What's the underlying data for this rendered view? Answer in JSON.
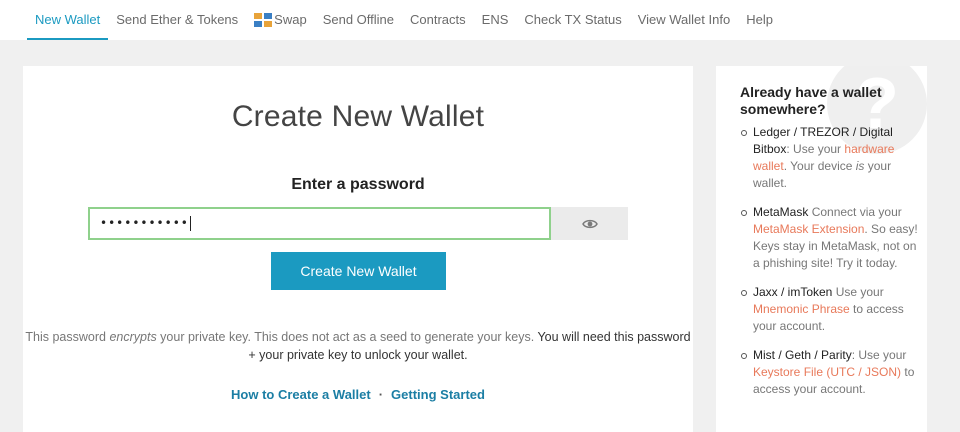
{
  "nav": {
    "items": [
      {
        "label": "New Wallet"
      },
      {
        "label": "Send Ether & Tokens"
      },
      {
        "label": "Swap"
      },
      {
        "label": "Send Offline"
      },
      {
        "label": "Contracts"
      },
      {
        "label": "ENS"
      },
      {
        "label": "Check TX Status"
      },
      {
        "label": "View Wallet Info"
      },
      {
        "label": "Help"
      }
    ],
    "active": "New Wallet"
  },
  "main": {
    "title": "Create New Wallet",
    "password_label": "Enter a password",
    "password_value": "•••••••••••",
    "create_button": "Create New Wallet",
    "notice": {
      "part1": "This password ",
      "part2": "encrypts",
      "part3": " your private key. This does not act as a seed to generate your keys. ",
      "part4": "You will need this password + your private key to unlock your wallet."
    },
    "links": {
      "how_to": "How to Create a Wallet",
      "sep": "·",
      "getting_started": "Getting Started"
    }
  },
  "sidebar": {
    "qmark": "?",
    "title": "Already have a wallet somewhere?",
    "items": [
      {
        "name": "Ledger / TREZOR / Digital Bitbox",
        "t1": ": Use your ",
        "link": "hardware wallet",
        "t2": ". Your device ",
        "em": "is",
        "t3": " your wallet."
      },
      {
        "name": "MetaMask",
        "t1": " Connect via your ",
        "link": "MetaMask Extension",
        "t2": ". So easy! Keys stay in MetaMask, not on a phishing site! Try it today."
      },
      {
        "name": "Jaxx / imToken",
        "t1": " Use your ",
        "link": "Mnemonic Phrase",
        "t2": " to access your account."
      },
      {
        "name": "Mist / Geth / Parity",
        "t1": ": Use your ",
        "link": "Keystore File (UTC / JSON)",
        "t2": " to access your account."
      }
    ]
  },
  "colors": {
    "accent": "#1b9ac1",
    "link_orange": "#e8795a",
    "input_border": "#8fd18c"
  }
}
